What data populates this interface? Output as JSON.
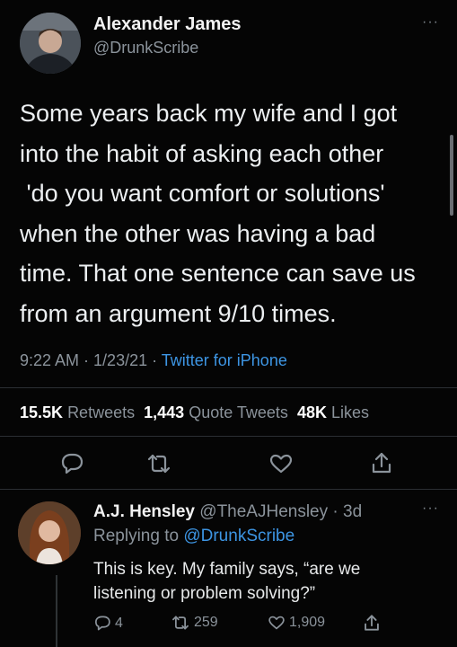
{
  "tweet": {
    "author_name": "Alexander James",
    "author_handle": "@DrunkScribe",
    "more_label": "···",
    "lines": [
      "Some years back my wife and I got",
      "into the habit of asking each other",
      " 'do you want comfort or solutions'",
      "when the other was having a bad",
      "time. That one sentence can save us",
      "from an argument 9/10 times."
    ],
    "time": "9:22 AM",
    "date": "1/23/21",
    "separator": " · ",
    "source": "Twitter for iPhone",
    "stats": {
      "retweets_count": "15.5K",
      "retweets_label": "Retweets",
      "quotes_count": "1,443",
      "quotes_label": "Quote Tweets",
      "likes_count": "48K",
      "likes_label": "Likes"
    }
  },
  "reply": {
    "author_name": "A.J. Hensley",
    "author_handle": "@TheAJHensley",
    "age": "3d",
    "replying_prefix": "Replying to",
    "replying_handle": "@DrunkScribe",
    "more_label": "···",
    "lines": [
      "This is key. My family says, “are we",
      "listening or problem solving?”"
    ],
    "reply_count": "4",
    "retweet_count": "259",
    "like_count": "1,909"
  },
  "icons": {
    "reply": "speech-bubble",
    "retweet": "retweet-arrows",
    "like": "heart",
    "share": "share-arrow-up"
  }
}
